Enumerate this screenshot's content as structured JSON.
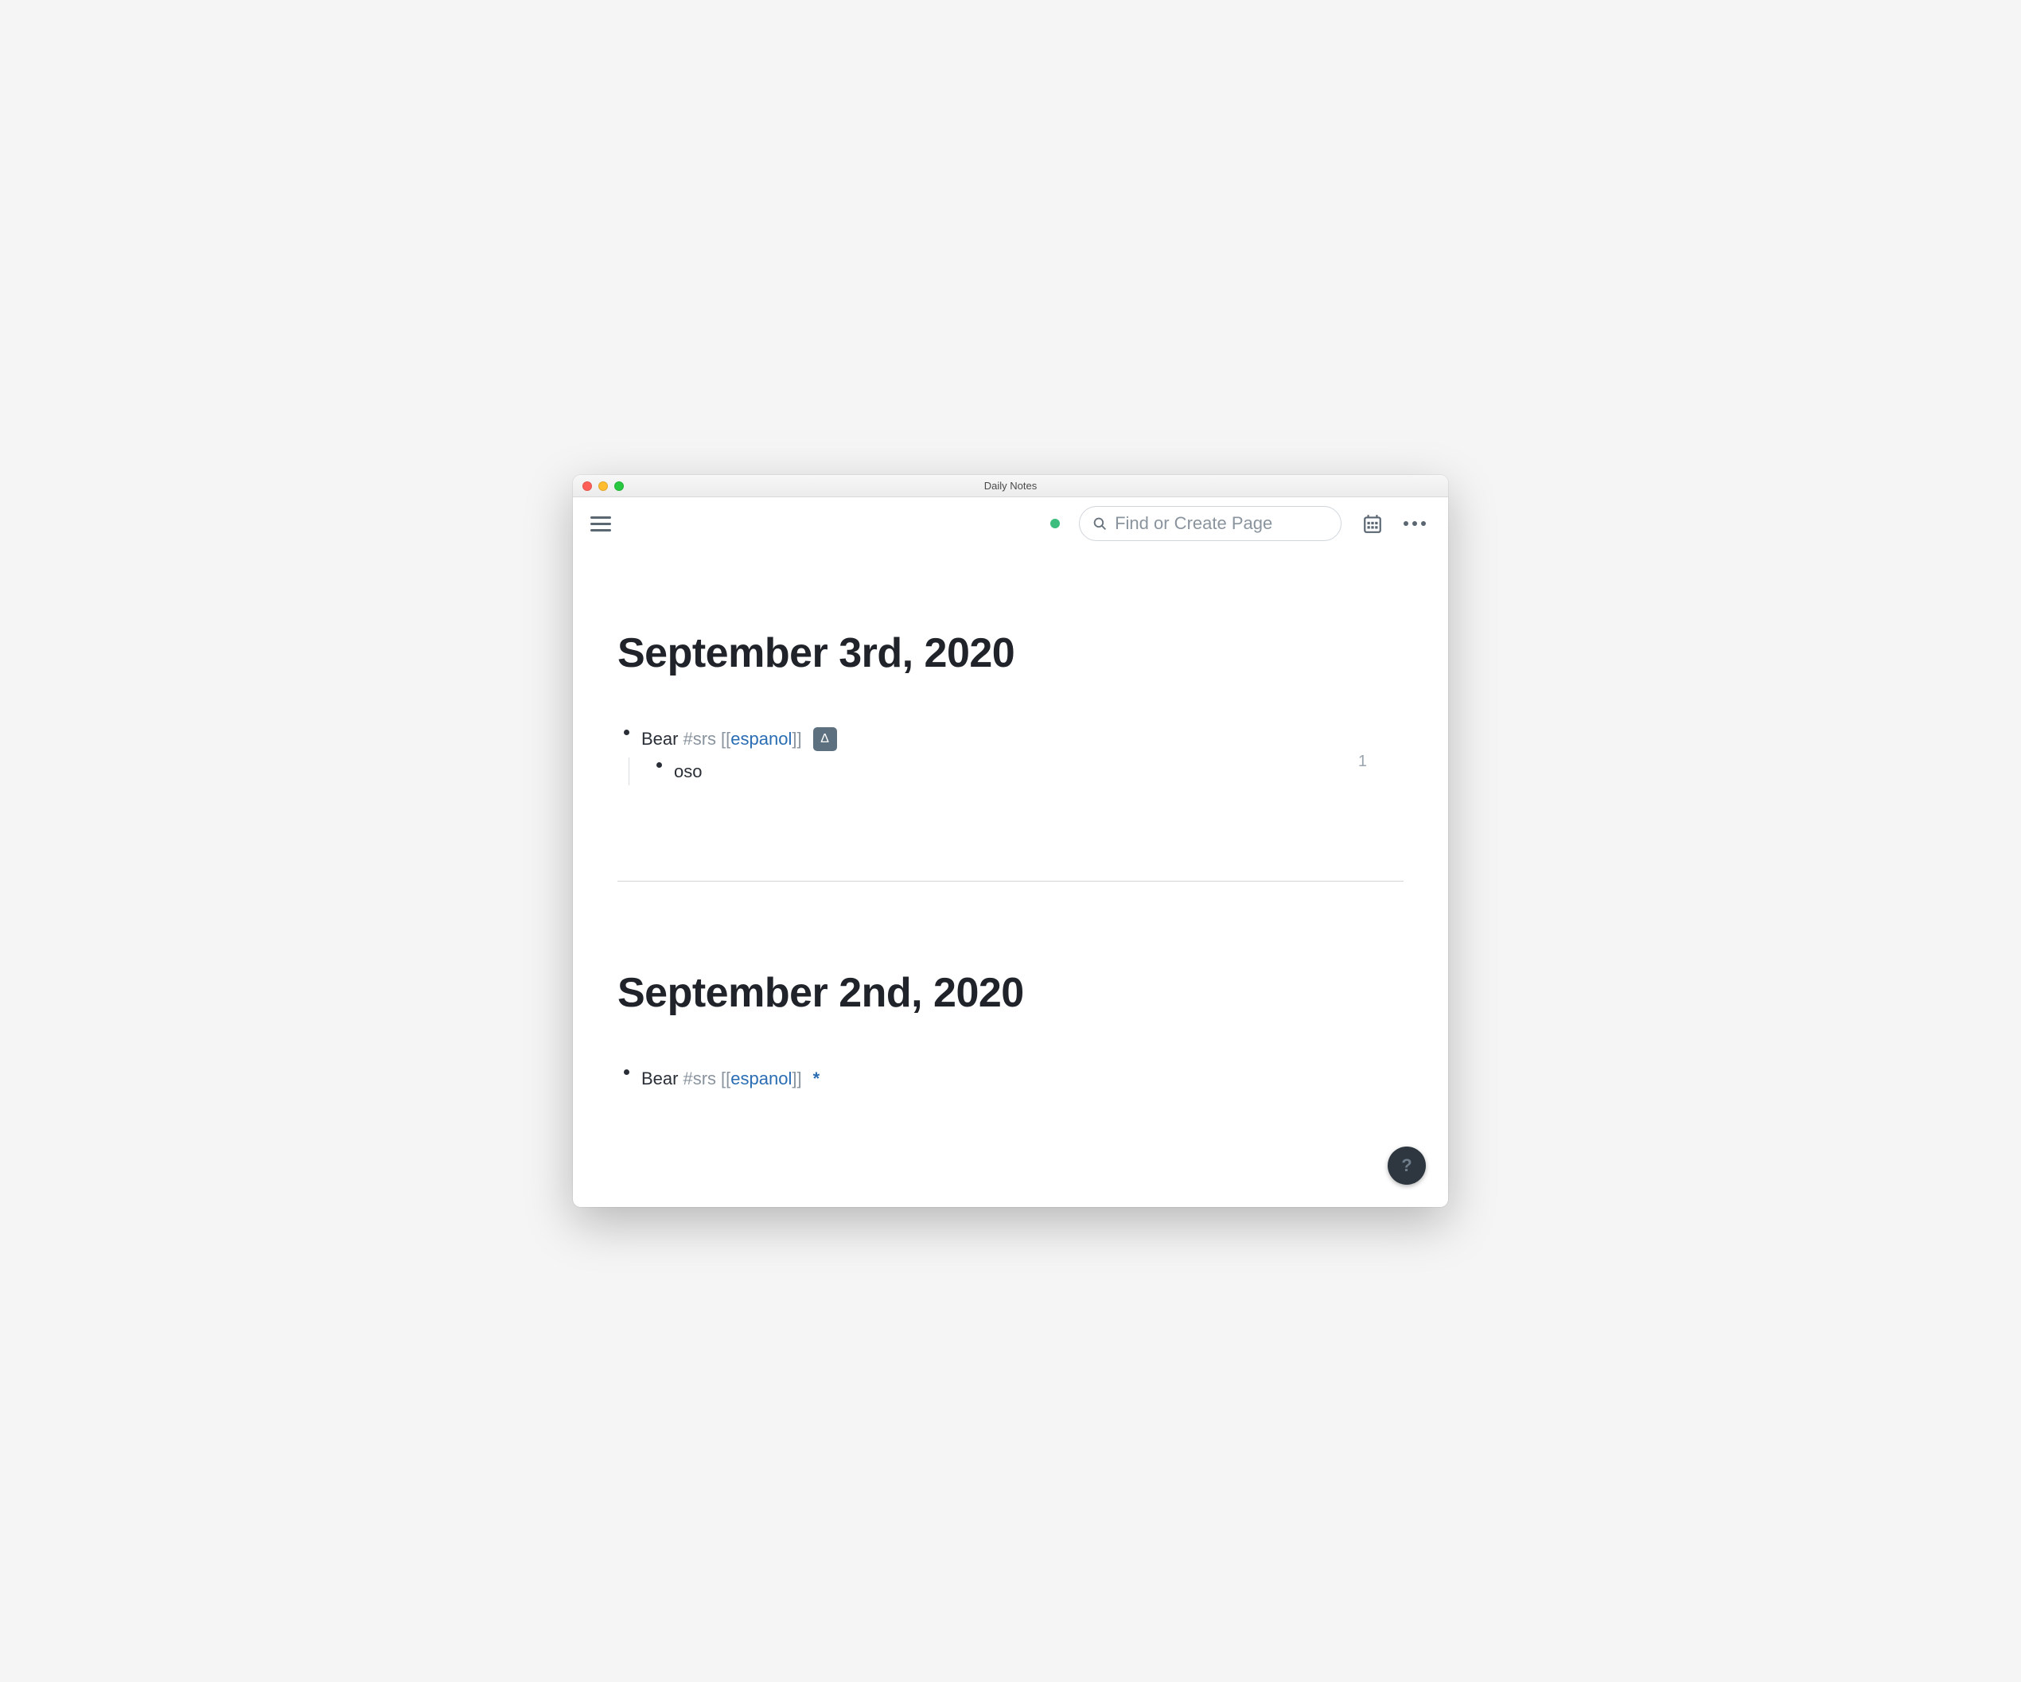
{
  "window": {
    "title": "Daily Notes"
  },
  "toolbar": {
    "search_placeholder": "Find or Create Page"
  },
  "days": [
    {
      "title": "September 3rd, 2020",
      "block": {
        "text": "Bear",
        "tag": "#srs",
        "ref": "espanol",
        "badge": "Δ",
        "ref_count": "1"
      },
      "child": {
        "text": "oso"
      }
    },
    {
      "title": "September 2nd, 2020",
      "block": {
        "text": "Bear",
        "tag": "#srs",
        "ref": "espanol",
        "marker": "*"
      }
    }
  ],
  "help": "?"
}
